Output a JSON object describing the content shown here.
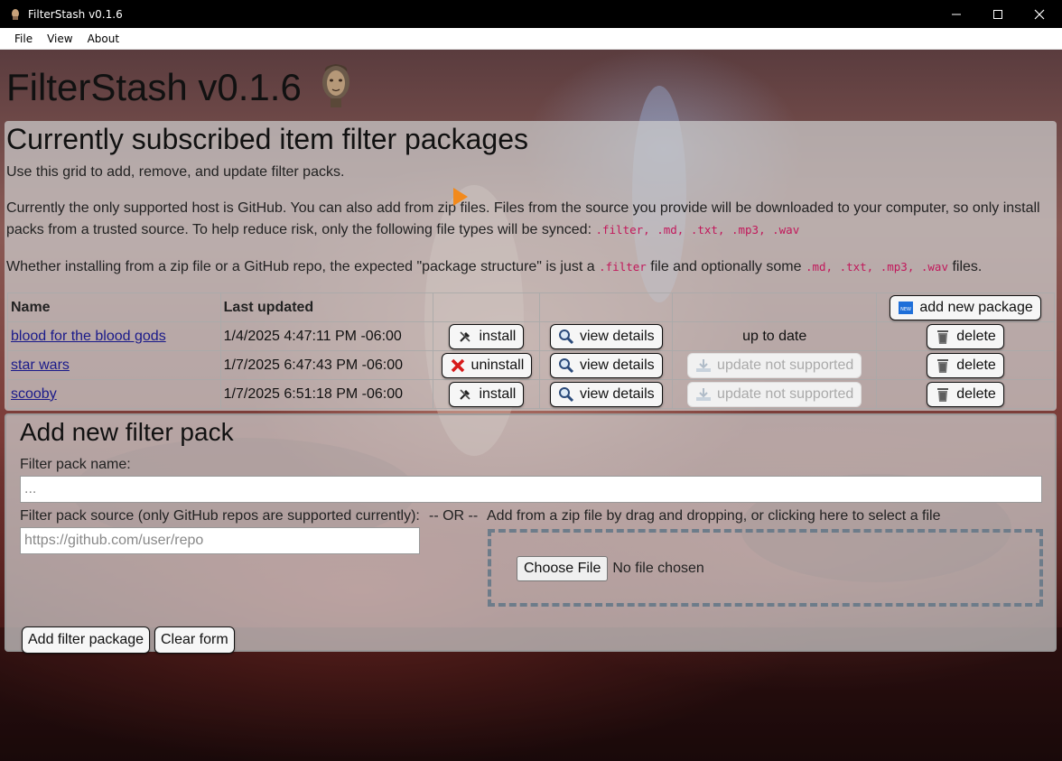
{
  "window": {
    "title": "FilterStash v0.1.6",
    "minimize_glyph": "—",
    "maximize_glyph": "☐",
    "close_glyph": "✕"
  },
  "menu": [
    "File",
    "View",
    "About"
  ],
  "app": {
    "heading": "FilterStash v0.1.6"
  },
  "subscribed": {
    "heading": "Currently subscribed item filter packages",
    "intro": "Use this grid to add, remove, and update filter packs.",
    "host_line_1": "Currently the only supported host is GitHub. You can also add from zip files. Files from the source you provide will be downloaded to your computer, so only install",
    "host_line_2": "packs from a trusted source. To help reduce risk, only the following file types will be synced:",
    "file_types": ".filter, .md, .txt, .mp3, .wav",
    "structure_pre": "Whether installing from a zip file or a GitHub repo, the expected \"package structure\" is just a",
    "structure_filter": ".filter",
    "structure_mid": "file and optionally some",
    "structure_exts": ".md, .txt, .mp3, .wav",
    "structure_post": "files.",
    "columns": {
      "name": "Name",
      "last_updated": "Last updated"
    },
    "add_new_button": "add new package",
    "rows": [
      {
        "name": "blood for the blood gods",
        "last_updated": "1/4/2025 4:47:11 PM -06:00",
        "install_action": "install",
        "details": "view details",
        "update_status": "up to date",
        "delete": "delete"
      },
      {
        "name": "star wars",
        "last_updated": "1/7/2025 6:47:43 PM -06:00",
        "install_action": "uninstall",
        "details": "view details",
        "update_status": "update not supported",
        "delete": "delete"
      },
      {
        "name": "scooby",
        "last_updated": "1/7/2025 6:51:18 PM -06:00",
        "install_action": "install",
        "details": "view details",
        "update_status": "update not supported",
        "delete": "delete"
      }
    ]
  },
  "add_form": {
    "heading": "Add new filter pack",
    "name_label": "Filter pack name:",
    "name_placeholder": "...",
    "source_label": "Filter pack source (only GitHub repos are supported currently):",
    "or_label": "-- OR --",
    "source_placeholder": "https://github.com/user/repo",
    "zip_label": "Add from a zip file by drag and dropping, or clicking here to select a file",
    "choose_file": "Choose File",
    "no_file": "No file chosen",
    "submit": "Add filter package",
    "clear": "Clear form"
  },
  "colors": {
    "code_accent": "#c2185b",
    "link": "#1a1a8a",
    "cursor": "#f28a1c"
  }
}
